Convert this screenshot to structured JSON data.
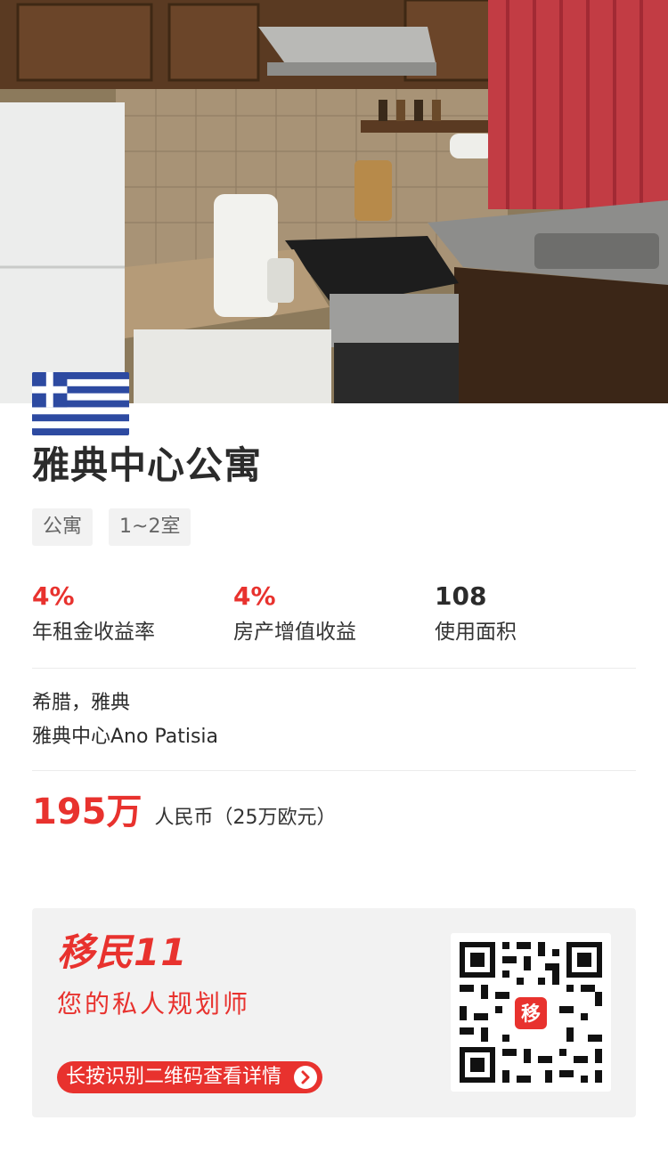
{
  "listing": {
    "title": "雅典中心公寓",
    "tags": [
      "公寓",
      "1~2室"
    ],
    "flag_colors": {
      "blue": "#2d4aa1",
      "white": "#ffffff"
    }
  },
  "stats": [
    {
      "value": "4%",
      "label": "年租金收益率",
      "color": "#e8322e"
    },
    {
      "value": "4%",
      "label": "房产增值收益",
      "color": "#e8322e"
    },
    {
      "value": "108",
      "label": "使用面积",
      "color": "#2b2b2b"
    }
  ],
  "location": {
    "region": "希腊，雅典",
    "area": "雅典中心Ano Patisia"
  },
  "price": {
    "amount": "195万",
    "currency_note": "人民币（25万欧元）"
  },
  "footer": {
    "brand": "移民11",
    "slogan": "您的私人规划师",
    "cta_label": "长按识别二维码查看详情",
    "qr_center_text": "移",
    "accent_color": "#e8322e"
  },
  "icons": {
    "flag": "greece-flag-icon",
    "cta_arrow": "chevron-right-circle-icon",
    "qr": "qr-code-icon"
  }
}
